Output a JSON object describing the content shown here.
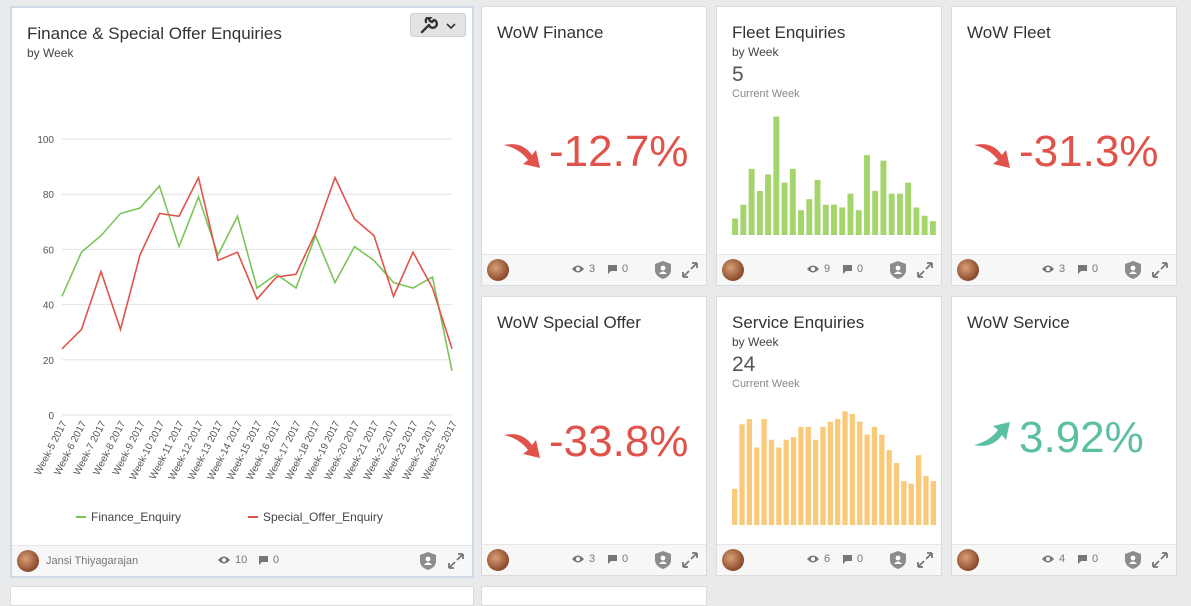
{
  "cards": {
    "finance_special": {
      "title": "Finance & Special Offer Enquiries",
      "subtitle": "by Week",
      "owner": "Jansi Thiyagarajan",
      "views": "10",
      "comments": "0"
    },
    "wow_finance": {
      "title": "WoW Finance",
      "value": "-12.7%",
      "trend": "down",
      "color": "#e0534a",
      "views": "3",
      "comments": "0"
    },
    "fleet": {
      "title": "Fleet Enquiries",
      "subtitle": "by Week",
      "kpi": "5",
      "kpi_caption": "Current Week",
      "views": "9",
      "comments": "0"
    },
    "wow_fleet": {
      "title": "WoW Fleet",
      "value": "-31.3%",
      "trend": "down",
      "color": "#e0534a",
      "views": "3",
      "comments": "0"
    },
    "wow_special": {
      "title": "WoW Special Offer",
      "value": "-33.8%",
      "trend": "down",
      "color": "#e0534a",
      "views": "3",
      "comments": "0"
    },
    "service": {
      "title": "Service Enquiries",
      "subtitle": "by Week",
      "kpi": "24",
      "kpi_caption": "Current Week",
      "views": "6",
      "comments": "0"
    },
    "wow_service": {
      "title": "WoW Service",
      "value": "3.92%",
      "trend": "up",
      "color": "#5bbfa3",
      "views": "4",
      "comments": "0"
    }
  },
  "chart_data": [
    {
      "type": "line",
      "categories": [
        "Week-5 2017",
        "Week-6 2017",
        "Week-7 2017",
        "Week-8 2017",
        "Week-9 2017",
        "Week-10 2017",
        "Week-11 2017",
        "Week-12 2017",
        "Week-13 2017",
        "Week-14 2017",
        "Week-15 2017",
        "Week-16 2017",
        "Week-17 2017",
        "Week-18 2017",
        "Week-19 2017",
        "Week-20 2017",
        "Week-21 2017",
        "Week-22 2017",
        "Week-23 2017",
        "Week-24 2017",
        "Week-25 2017"
      ],
      "yticks": [
        "0",
        "20",
        "40",
        "60",
        "80",
        "100"
      ],
      "ylim": [
        0,
        100
      ],
      "grid": true,
      "legend": "bottom",
      "series": [
        {
          "name": "Finance_Enquiry",
          "color": "#7cc45a",
          "values": [
            43,
            59,
            65,
            73,
            75,
            83,
            61,
            79,
            58,
            72,
            46,
            51,
            46,
            65,
            48,
            61,
            56,
            48,
            46,
            50,
            16
          ]
        },
        {
          "name": "Special_Offer_Enquiry",
          "color": "#e0534a",
          "values": [
            24,
            31,
            52,
            31,
            58,
            73,
            72,
            86,
            56,
            59,
            42,
            50,
            51,
            66,
            86,
            71,
            65,
            43,
            59,
            46,
            24
          ]
        }
      ]
    },
    {
      "type": "bar",
      "color": "#a4d46c",
      "values": [
        6,
        11,
        24,
        16,
        22,
        43,
        19,
        24,
        9,
        13,
        20,
        11,
        11,
        10,
        15,
        9,
        29,
        16,
        27,
        15,
        15,
        19,
        10,
        7,
        5
      ],
      "ylim": [
        0,
        45
      ]
    },
    {
      "type": "bar",
      "color": "#fbc97a",
      "values": [
        14,
        39,
        41,
        30,
        41,
        33,
        30,
        33,
        34,
        38,
        38,
        33,
        38,
        40,
        41,
        44,
        43,
        40,
        35,
        38,
        35,
        29,
        24,
        17,
        16,
        27,
        19,
        17
      ],
      "ylim": [
        0,
        48
      ]
    }
  ],
  "icons": [
    "eye-icon",
    "comment-icon",
    "shield-icon",
    "expand-icon",
    "wrench-icon",
    "chevron-down-icon",
    "trend-arrow-icon"
  ]
}
